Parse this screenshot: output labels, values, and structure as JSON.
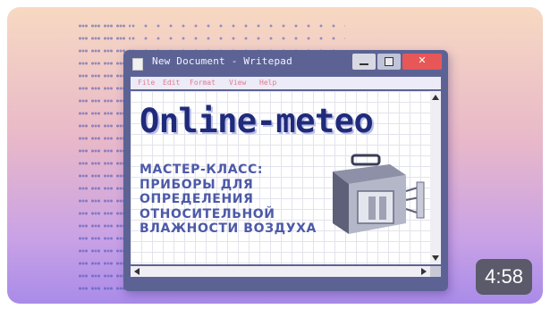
{
  "thumbnail": {
    "duration": "4:58"
  },
  "window": {
    "title": "New Document - Writepad",
    "menu": [
      "File",
      "Edit",
      "Format",
      "View",
      "Help"
    ]
  },
  "document": {
    "headline": "Online-meteo",
    "subtitle_lines": [
      "МАСТЕР-КЛАСС:",
      "ПРИБОРЫ ДЛЯ",
      "ОПРЕДЕЛЕНИЯ",
      "ОТНОСИТЕЛЬНОЙ",
      "ВЛАЖНОСТИ ВОЗДУХА"
    ]
  },
  "icons": {
    "app": "document-icon",
    "device": "hygrometer-device-icon"
  }
}
